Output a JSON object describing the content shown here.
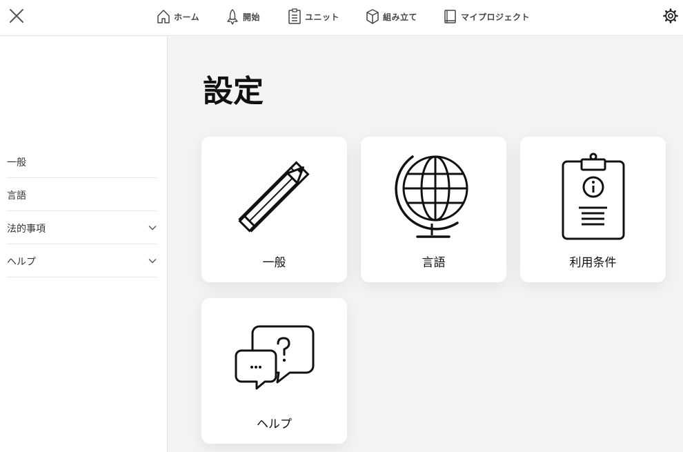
{
  "topbar": {
    "close_icon": "close-icon",
    "settings_icon": "gear-icon",
    "nav": [
      {
        "label": "ホーム",
        "icon": "home-icon"
      },
      {
        "label": "開始",
        "icon": "rocket-icon"
      },
      {
        "label": "ユニット",
        "icon": "clipboard-list-icon"
      },
      {
        "label": "組み立て",
        "icon": "box-icon"
      },
      {
        "label": "マイプロジェクト",
        "icon": "book-icon"
      }
    ]
  },
  "sidebar": {
    "items": [
      {
        "label": "一般",
        "expandable": false
      },
      {
        "label": "言語",
        "expandable": false
      },
      {
        "label": "法的事項",
        "expandable": true
      },
      {
        "label": "ヘルプ",
        "expandable": true
      }
    ]
  },
  "main": {
    "title": "設定",
    "cards": [
      {
        "label": "一般",
        "icon": "ruler-pencil-icon"
      },
      {
        "label": "言語",
        "icon": "globe-icon"
      },
      {
        "label": "利用条件",
        "icon": "clipboard-info-icon"
      },
      {
        "label": "ヘルプ",
        "icon": "chat-bubbles-icon"
      }
    ]
  }
}
